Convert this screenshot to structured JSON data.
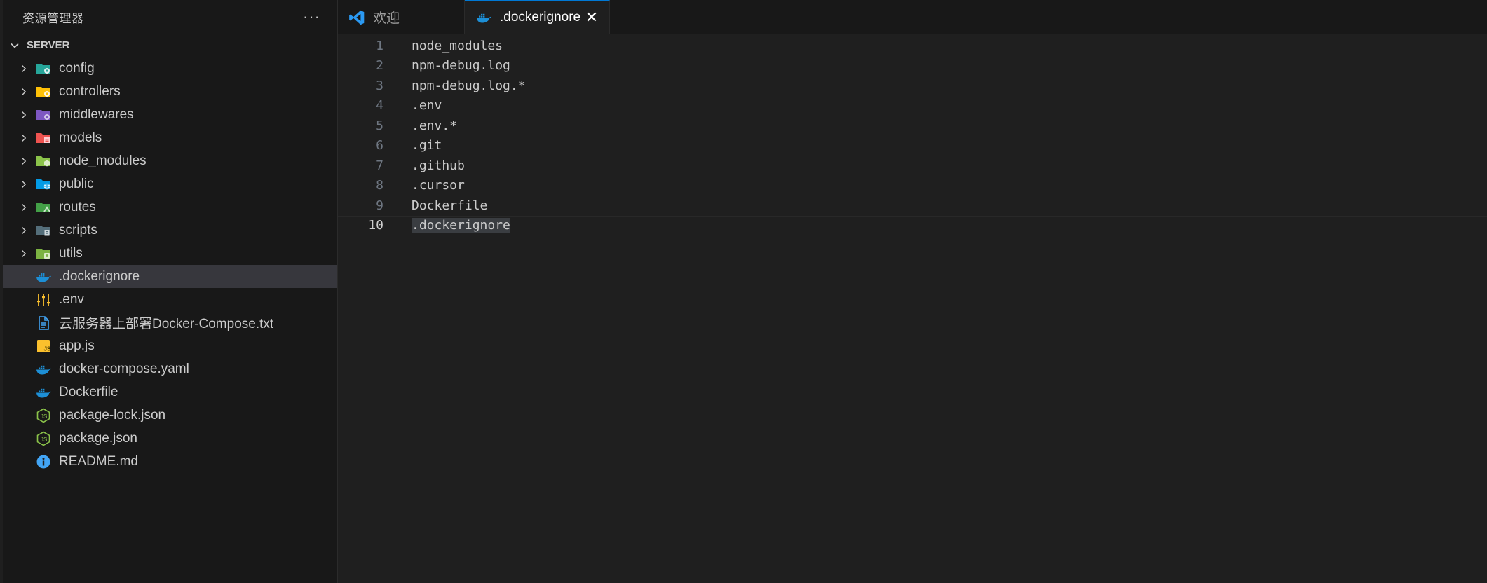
{
  "sidebar": {
    "title": "资源管理器",
    "more_label": "···",
    "section": "SERVER",
    "folders": [
      {
        "label": "config",
        "icon": "folder-config-icon",
        "color": "#26a69a"
      },
      {
        "label": "controllers",
        "icon": "folder-controller-icon",
        "color": "#ffc107"
      },
      {
        "label": "middlewares",
        "icon": "folder-middleware-icon",
        "color": "#7e57c2"
      },
      {
        "label": "models",
        "icon": "folder-models-icon",
        "color": "#ef5350"
      },
      {
        "label": "node_modules",
        "icon": "folder-node-icon",
        "color": "#8bc34a"
      },
      {
        "label": "public",
        "icon": "folder-public-icon",
        "color": "#039be5"
      },
      {
        "label": "routes",
        "icon": "folder-routes-icon",
        "color": "#43a047"
      },
      {
        "label": "scripts",
        "icon": "folder-scripts-icon",
        "color": "#546e7a"
      },
      {
        "label": "utils",
        "icon": "folder-utils-icon",
        "color": "#7cb342"
      }
    ],
    "files": [
      {
        "label": ".dockerignore",
        "icon": "docker-icon",
        "selected": true
      },
      {
        "label": ".env",
        "icon": "env-settings-icon"
      },
      {
        "label": "云服务器上部署Docker-Compose.txt",
        "icon": "text-file-icon"
      },
      {
        "label": "app.js",
        "icon": "javascript-icon"
      },
      {
        "label": "docker-compose.yaml",
        "icon": "docker-icon"
      },
      {
        "label": "Dockerfile",
        "icon": "docker-icon"
      },
      {
        "label": "package-lock.json",
        "icon": "nodejs-icon"
      },
      {
        "label": "package.json",
        "icon": "nodejs-icon"
      },
      {
        "label": "README.md",
        "icon": "info-icon"
      }
    ]
  },
  "tabs": [
    {
      "label": "欢迎",
      "icon": "vscode-icon",
      "active": false
    },
    {
      "label": ".dockerignore",
      "icon": "docker-icon",
      "active": true,
      "close": "✕"
    }
  ],
  "editor": {
    "lines": [
      {
        "n": "1",
        "text": "node_modules"
      },
      {
        "n": "2",
        "text": "npm-debug.log"
      },
      {
        "n": "3",
        "text": "npm-debug.log.*"
      },
      {
        "n": "4",
        "text": ".env"
      },
      {
        "n": "5",
        "text": ".env.*"
      },
      {
        "n": "6",
        "text": ".git"
      },
      {
        "n": "7",
        "text": ".github"
      },
      {
        "n": "8",
        "text": ".cursor"
      },
      {
        "n": "9",
        "text": "Dockerfile"
      },
      {
        "n": "10",
        "text": ".dockerignore"
      }
    ],
    "current_line": "10"
  },
  "colors": {
    "accent": "#0078d4",
    "docker": "#1d8fd6",
    "selection": "#37373d"
  }
}
